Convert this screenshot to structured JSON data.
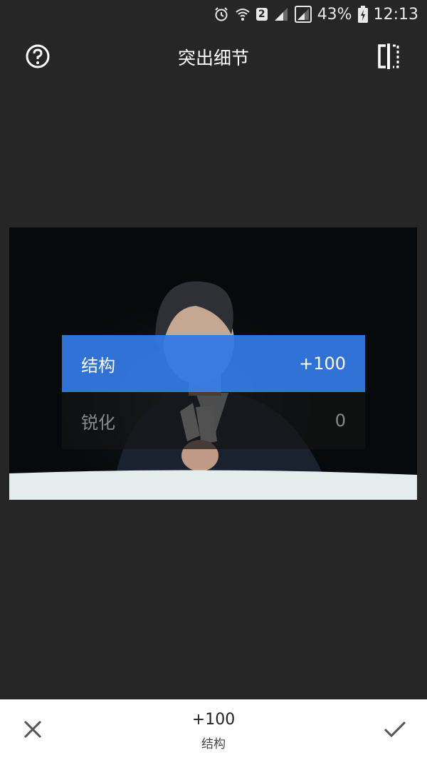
{
  "status_bar": {
    "icons": [
      "alarm-icon",
      "wifi-icon",
      "sim2-badge",
      "signal-icon",
      "signal-icon-2",
      "battery-charging-icon"
    ],
    "sim_badge": "2",
    "battery_percent": "43%",
    "time": "12:13"
  },
  "header": {
    "title": "突出细节",
    "help_icon": "help-icon",
    "compare_icon": "compare-icon"
  },
  "adjustments": [
    {
      "label": "结构",
      "value": "+100",
      "selected": true
    },
    {
      "label": "锐化",
      "value": "0",
      "selected": false
    }
  ],
  "bottom_bar": {
    "value": "+100",
    "label": "结构",
    "cancel_icon": "close-icon",
    "apply_icon": "check-icon"
  },
  "colors": {
    "background": "#262626",
    "accent": "#3478E1",
    "bottom_bar": "#FFFFFF"
  }
}
